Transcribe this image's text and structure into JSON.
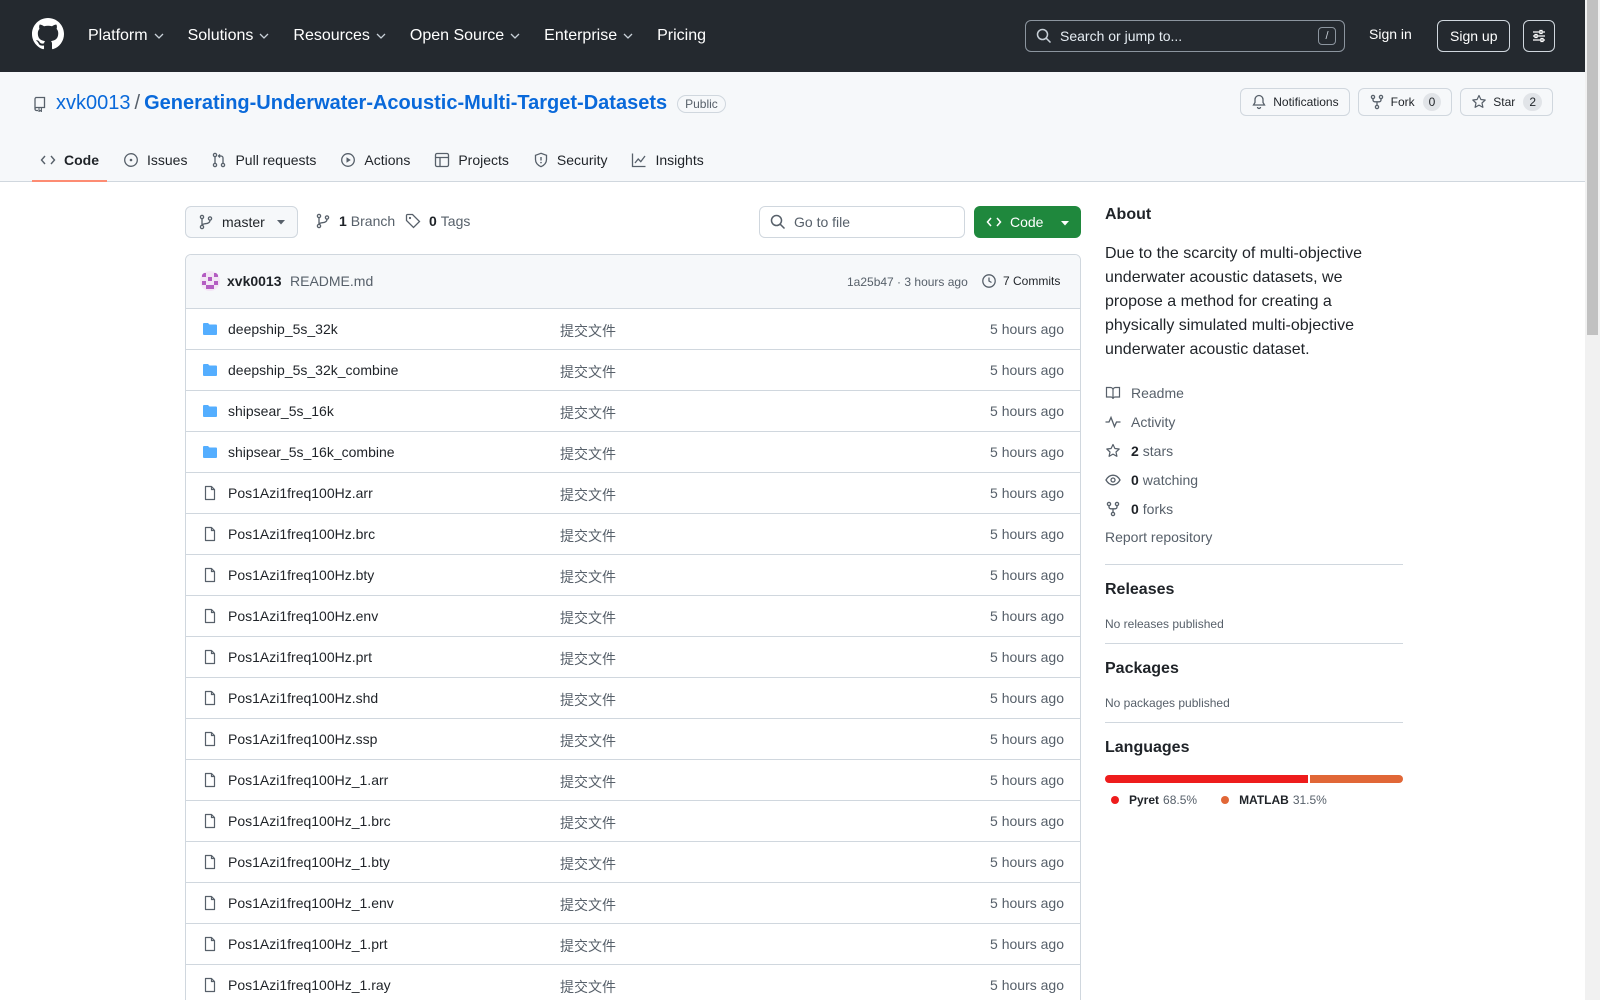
{
  "header": {
    "nav": [
      "Platform",
      "Solutions",
      "Resources",
      "Open Source",
      "Enterprise",
      "Pricing"
    ],
    "search_placeholder": "Search or jump to...",
    "search_key": "/",
    "sign_in": "Sign in",
    "sign_up": "Sign up"
  },
  "repo": {
    "owner": "xvk0013",
    "separator": "/",
    "name": "Generating-Underwater-Acoustic-Multi-Target-Datasets",
    "visibility": "Public",
    "notifications_label": "Notifications",
    "fork_label": "Fork",
    "fork_count": "0",
    "star_label": "Star",
    "star_count": "2"
  },
  "tabs": [
    {
      "label": "Code",
      "icon": "code-icon"
    },
    {
      "label": "Issues",
      "icon": "issue-icon"
    },
    {
      "label": "Pull requests",
      "icon": "pull-request-icon"
    },
    {
      "label": "Actions",
      "icon": "play-icon"
    },
    {
      "label": "Projects",
      "icon": "table-icon"
    },
    {
      "label": "Security",
      "icon": "shield-icon"
    },
    {
      "label": "Insights",
      "icon": "graph-icon"
    }
  ],
  "filebar": {
    "branch": "master",
    "branch_count": "1",
    "branch_label": "Branch",
    "tag_count": "0",
    "tag_label": "Tags",
    "goto_placeholder": "Go to file",
    "code_label": "Code"
  },
  "commit": {
    "author": "xvk0013",
    "message": "README.md",
    "meta": "1a25b47 · 3 hours ago",
    "commits_label": "7 Commits"
  },
  "files": [
    {
      "name": "deepship_5s_32k",
      "type": "folder",
      "message": "提交文件",
      "time": "5 hours ago"
    },
    {
      "name": "deepship_5s_32k_combine",
      "type": "folder",
      "message": "提交文件",
      "time": "5 hours ago"
    },
    {
      "name": "shipsear_5s_16k",
      "type": "folder",
      "message": "提交文件",
      "time": "5 hours ago"
    },
    {
      "name": "shipsear_5s_16k_combine",
      "type": "folder",
      "message": "提交文件",
      "time": "5 hours ago"
    },
    {
      "name": "Pos1Azi1freq100Hz.arr",
      "type": "file",
      "message": "提交文件",
      "time": "5 hours ago"
    },
    {
      "name": "Pos1Azi1freq100Hz.brc",
      "type": "file",
      "message": "提交文件",
      "time": "5 hours ago"
    },
    {
      "name": "Pos1Azi1freq100Hz.bty",
      "type": "file",
      "message": "提交文件",
      "time": "5 hours ago"
    },
    {
      "name": "Pos1Azi1freq100Hz.env",
      "type": "file",
      "message": "提交文件",
      "time": "5 hours ago"
    },
    {
      "name": "Pos1Azi1freq100Hz.prt",
      "type": "file",
      "message": "提交文件",
      "time": "5 hours ago"
    },
    {
      "name": "Pos1Azi1freq100Hz.shd",
      "type": "file",
      "message": "提交文件",
      "time": "5 hours ago"
    },
    {
      "name": "Pos1Azi1freq100Hz.ssp",
      "type": "file",
      "message": "提交文件",
      "time": "5 hours ago"
    },
    {
      "name": "Pos1Azi1freq100Hz_1.arr",
      "type": "file",
      "message": "提交文件",
      "time": "5 hours ago"
    },
    {
      "name": "Pos1Azi1freq100Hz_1.brc",
      "type": "file",
      "message": "提交文件",
      "time": "5 hours ago"
    },
    {
      "name": "Pos1Azi1freq100Hz_1.bty",
      "type": "file",
      "message": "提交文件",
      "time": "5 hours ago"
    },
    {
      "name": "Pos1Azi1freq100Hz_1.env",
      "type": "file",
      "message": "提交文件",
      "time": "5 hours ago"
    },
    {
      "name": "Pos1Azi1freq100Hz_1.prt",
      "type": "file",
      "message": "提交文件",
      "time": "5 hours ago"
    },
    {
      "name": "Pos1Azi1freq100Hz_1.ray",
      "type": "file",
      "message": "提交文件",
      "time": "5 hours ago"
    }
  ],
  "about": {
    "heading": "About",
    "description": "Due to the scarcity of multi-objective underwater acoustic datasets, we propose a method for creating a physically simulated multi-objective underwater acoustic dataset.",
    "readme": "Readme",
    "activity": "Activity",
    "stars_count": "2",
    "stars_label": "stars",
    "watching_count": "0",
    "watching_label": "watching",
    "forks_count": "0",
    "forks_label": "forks",
    "report": "Report repository"
  },
  "releases": {
    "heading": "Releases",
    "text": "No releases published"
  },
  "packages": {
    "heading": "Packages",
    "text": "No packages published"
  },
  "languages": {
    "heading": "Languages",
    "items": [
      {
        "name": "Pyret",
        "percent": "68.5%",
        "value": 68.5,
        "color": "#ee1c1c"
      },
      {
        "name": "MATLAB",
        "percent": "31.5%",
        "value": 31.5,
        "color": "#e16737"
      }
    ]
  },
  "colors": {
    "header_bg": "#24292f",
    "link": "#0969da",
    "primary_button": "#1f883d",
    "active_tab_underline": "#fd8c73",
    "folder": "#54aeff"
  }
}
